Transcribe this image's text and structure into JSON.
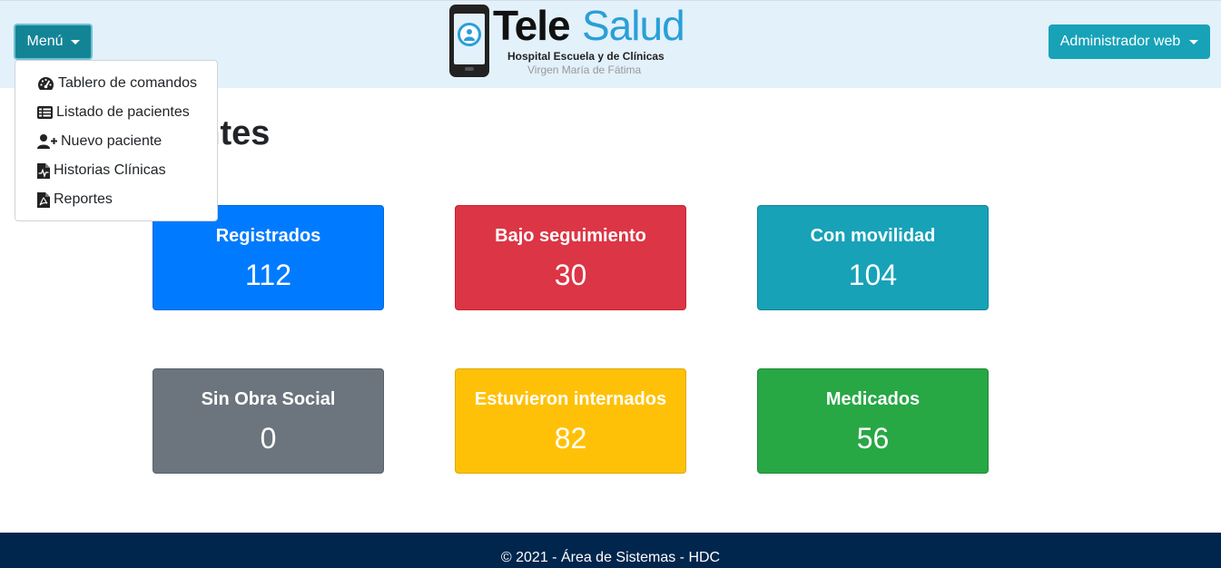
{
  "header": {
    "menu_label": "Menú",
    "user_label": "Administrador web",
    "brand": {
      "name_part1": "Tele",
      "name_part2": "Salud",
      "subtitle1": "Hospital Escuela y de Clínicas",
      "subtitle2": "Virgen María de Fátima"
    }
  },
  "menu": {
    "items": [
      {
        "label": "Tablero de comandos",
        "icon": "tachometer-icon"
      },
      {
        "label": "Listado de pacientes",
        "icon": "list-icon"
      },
      {
        "label": "Nuevo paciente",
        "icon": "user-plus-icon"
      },
      {
        "label": "Historias Clínicas",
        "icon": "medical-file-icon"
      },
      {
        "label": "Reportes",
        "icon": "pdf-file-icon"
      }
    ]
  },
  "main": {
    "title": "Pacientes"
  },
  "stats": [
    {
      "label": "Registrados",
      "value": "112",
      "color": "#007bff"
    },
    {
      "label": "Bajo seguimiento",
      "value": "30",
      "color": "#dc3545"
    },
    {
      "label": "Con movilidad",
      "value": "104",
      "color": "#17a2b8"
    },
    {
      "label": "Sin Obra Social",
      "value": "0",
      "color": "#6c757d"
    },
    {
      "label": "Estuvieron internados",
      "value": "82",
      "color": "#ffc107"
    },
    {
      "label": "Medicados",
      "value": "56",
      "color": "#28a745"
    }
  ],
  "footer": {
    "text": "© 2021 - Área de Sistemas - HDC"
  }
}
